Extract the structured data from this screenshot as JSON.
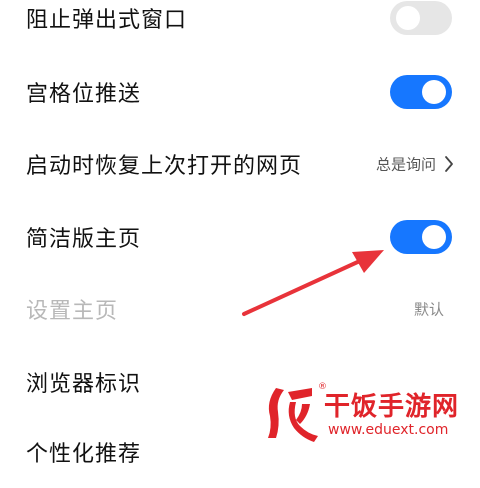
{
  "settings": {
    "rows": [
      {
        "label": "阻止弹出式窗口",
        "control": "toggle",
        "state": "off"
      },
      {
        "label": "宫格位推送",
        "control": "toggle",
        "state": "on"
      },
      {
        "label": "启动时恢复上次打开的网页",
        "control": "value",
        "value": "总是询问"
      },
      {
        "label": "简洁版主页",
        "control": "toggle",
        "state": "on"
      },
      {
        "label": "设置主页",
        "control": "value",
        "value": "默认",
        "disabled": true
      },
      {
        "label": "浏览器标识",
        "control": "none"
      },
      {
        "label": "个性化推荐",
        "control": "none"
      }
    ]
  },
  "icons": {
    "chevron": "chevron-right-icon",
    "annotation": "red-arrow-annotation",
    "watermark_logo": "fan-logo-icon"
  },
  "colors": {
    "toggle_on": "#1677ff",
    "toggle_off": "#e6e6e6",
    "annotation_arrow": "#e8333a",
    "watermark": "#e0242a"
  },
  "watermark": {
    "title": "干饭手游网",
    "url": "www.eduext.com",
    "registered_mark": "®"
  }
}
